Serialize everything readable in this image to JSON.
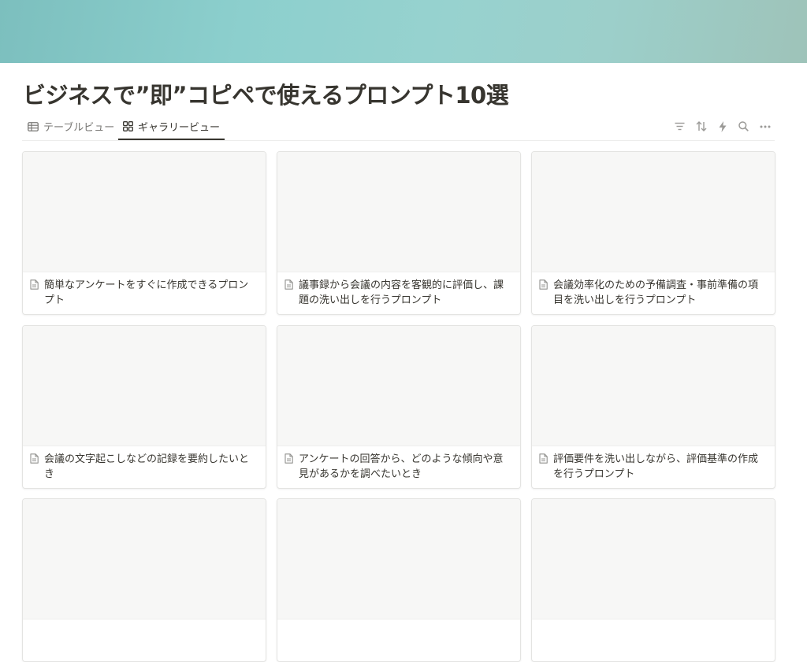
{
  "page": {
    "title": "ビジネスで”即”コピペで使えるプロンプト10選"
  },
  "views": {
    "tabs": [
      {
        "label": "テーブルビュー",
        "icon": "table-icon",
        "active": false
      },
      {
        "label": "ギャラリービュー",
        "icon": "gallery-icon",
        "active": true
      }
    ],
    "tools": [
      "filter-icon",
      "sort-icon",
      "automation-lightning-icon",
      "search-icon",
      "more-options-icon"
    ]
  },
  "gallery": {
    "cards": [
      {
        "title": "簡単なアンケートをすぐに作成できるプロンプト"
      },
      {
        "title": "議事録から会議の内容を客観的に評価し、課題の洗い出しを行うプロンプト"
      },
      {
        "title": "会議効率化のための予備調査・事前準備の項目を洗い出しを行うプロンプト"
      },
      {
        "title": "会議の文字起こしなどの記録を要約したいとき"
      },
      {
        "title": "アンケートの回答から、どのような傾向や意見があるかを調べたいとき"
      },
      {
        "title": "評価要件を洗い出しながら、評価基準の作成を行うプロンプト"
      },
      {
        "title": ""
      },
      {
        "title": ""
      },
      {
        "title": ""
      }
    ]
  }
}
